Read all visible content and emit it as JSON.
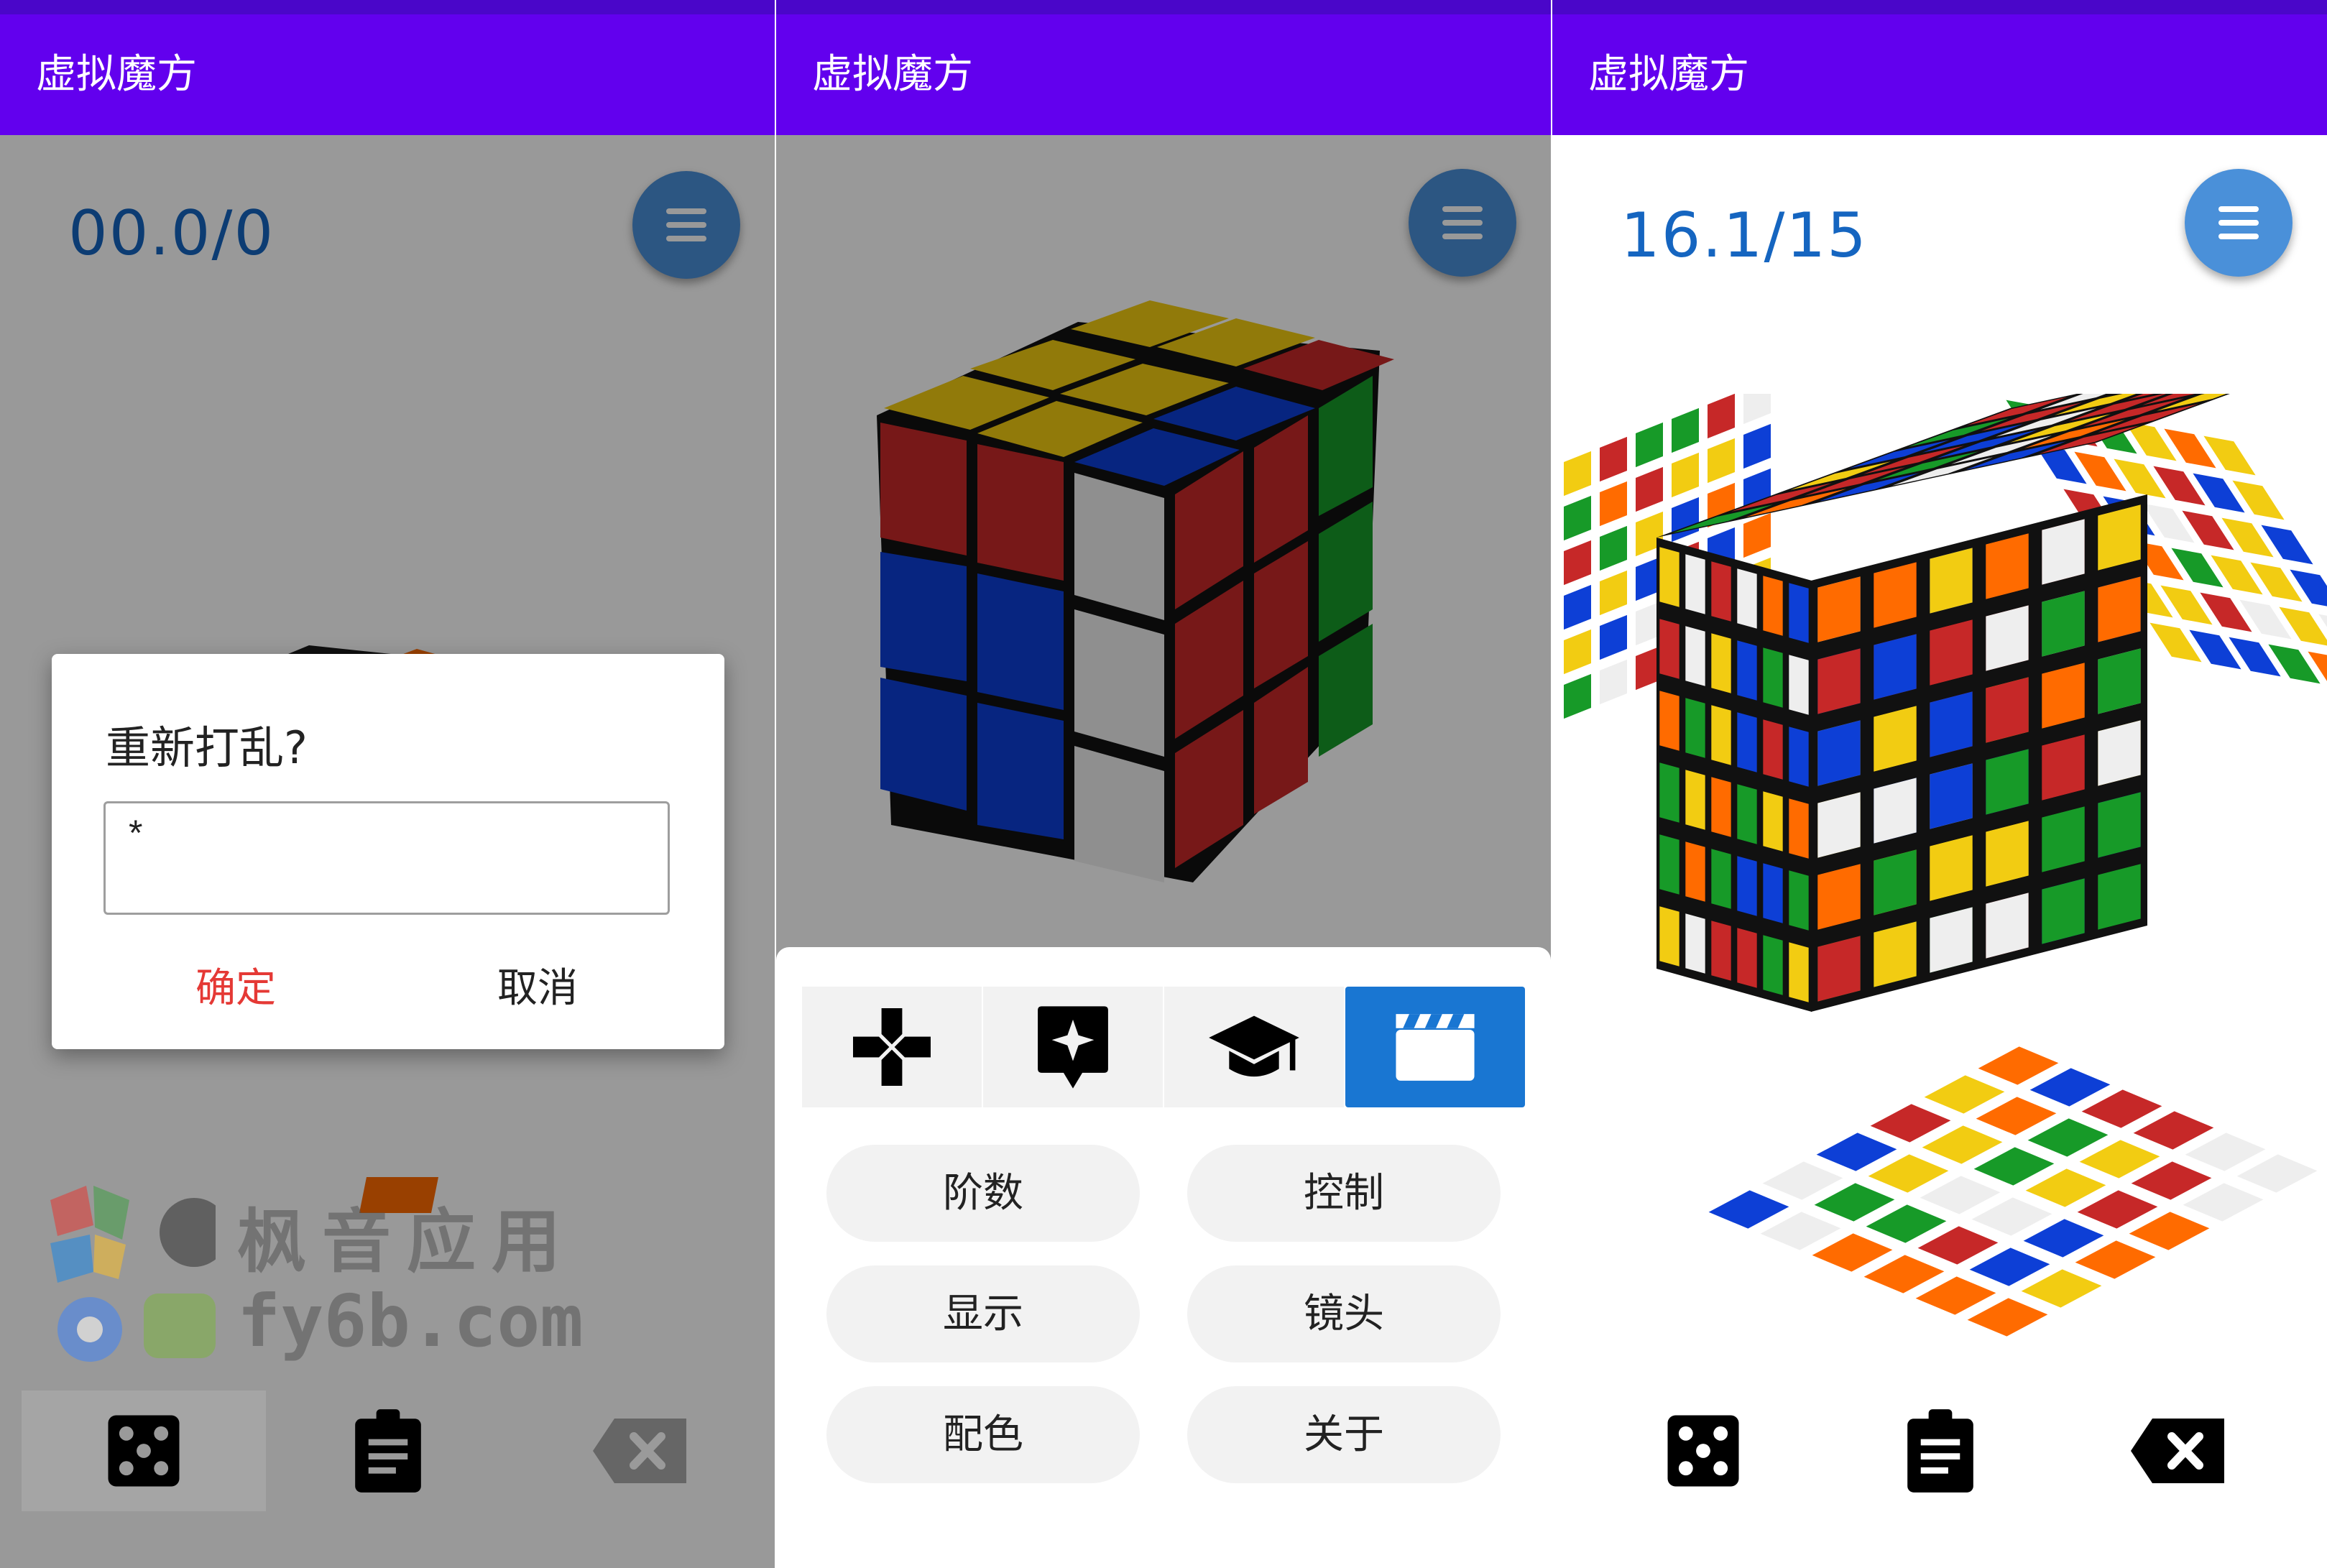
{
  "app_title": "虚拟魔方",
  "screens": {
    "scramble_dialog": {
      "timer": "00.0/0",
      "dialog": {
        "title": "重新打乱?",
        "input_value": "*",
        "confirm_label": "确定",
        "cancel_label": "取消"
      },
      "watermark": {
        "line1": "枫音应用",
        "line2": "fy6b.com"
      }
    },
    "menu_sheet": {
      "tabs": [
        {
          "icon": "gamepad-icon",
          "active": false
        },
        {
          "icon": "sparkle-chat-icon",
          "active": false
        },
        {
          "icon": "graduation-cap-icon",
          "active": false
        },
        {
          "icon": "clapperboard-icon",
          "active": true
        }
      ],
      "options": [
        "阶数",
        "控制",
        "显示",
        "镜头",
        "配色",
        "关于"
      ]
    },
    "big_cube": {
      "timer": "16.1/15"
    }
  },
  "bottom_bar_icons": [
    "dice-icon",
    "clipboard-icon",
    "backspace-icon"
  ],
  "colors": {
    "app_bar": "#6200ee",
    "status_strip": "#4a06c9",
    "timer_text": "#1565c0",
    "fab": "#4a90d9",
    "confirm_text": "#e53935",
    "active_tab": "#1976d2",
    "cube_red": "#c62828",
    "cube_blue": "#0d3fd6",
    "cube_yellow": "#f2cc12",
    "cube_green": "#179a28",
    "cube_white": "#eeeeee",
    "cube_orange": "#ff6b00"
  }
}
